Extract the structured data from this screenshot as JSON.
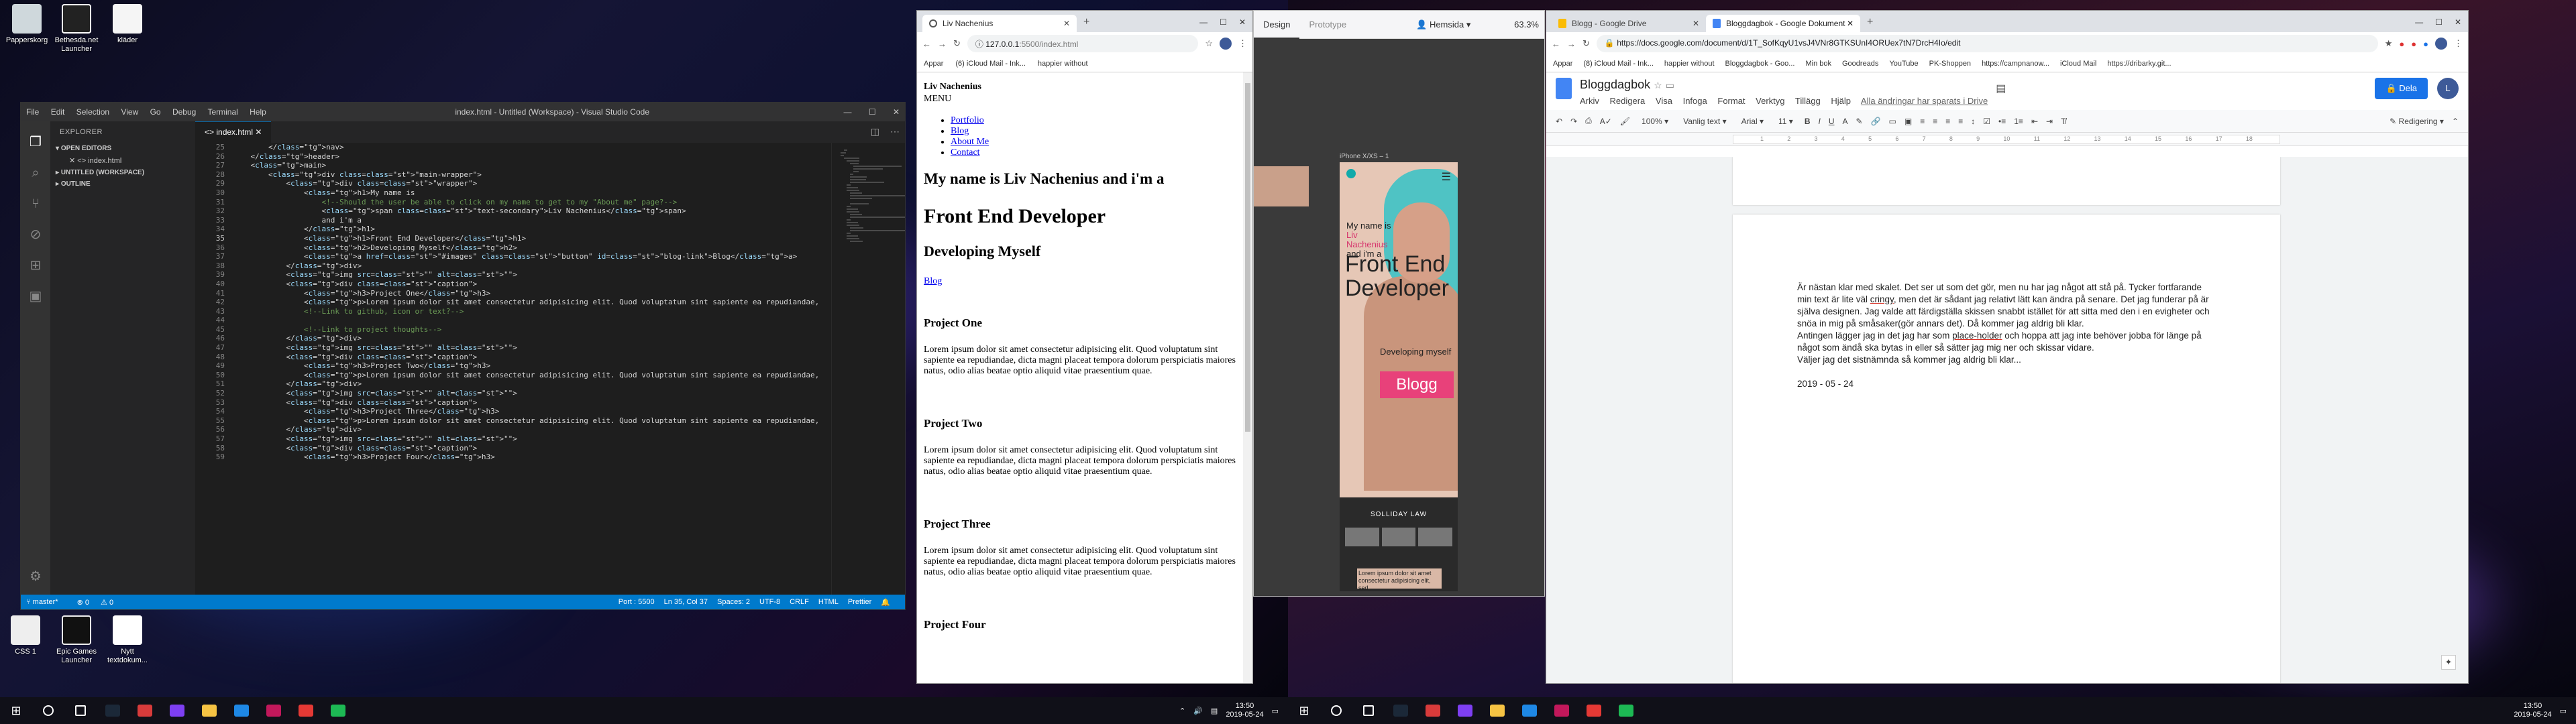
{
  "desktop": {
    "icons_left": [
      {
        "label": "Papperskorg",
        "color": "#cfd8dc"
      },
      {
        "label": "Bethesda.net Launcher",
        "color": "#222222"
      },
      {
        "label": "kläder",
        "color": "#f5f5f5"
      },
      {
        "label": "CSS 1",
        "color": "#eeeeee"
      },
      {
        "label": "Epic Games Launcher",
        "color": "#111111"
      },
      {
        "label": "Nytt textdokum...",
        "color": "#ffffff"
      }
    ]
  },
  "vscode": {
    "window_title": "index.html - Untitled (Workspace) - Visual Studio Code",
    "menu": [
      "File",
      "Edit",
      "Selection",
      "View",
      "Go",
      "Debug",
      "Terminal",
      "Help"
    ],
    "sidebar_title": "EXPLORER",
    "open_editors": "OPEN EDITORS",
    "open_file": "index.html",
    "workspace": "UNTITLED (WORKSPACE)",
    "outline": "OUTLINE",
    "tab": "index.html",
    "line_numbers": [
      "25",
      "26",
      "27",
      "28",
      "29",
      "30",
      "31",
      "32",
      "33",
      "34",
      "35",
      "36",
      "37",
      "38",
      "39",
      "40",
      "41",
      "42",
      "43",
      "44",
      "45",
      "46",
      "47",
      "48",
      "49",
      "50",
      "51",
      "52",
      "53",
      "54",
      "55",
      "56",
      "57",
      "58",
      "59"
    ],
    "code_lines": [
      "        </nav>",
      "    </header>",
      "    <main>",
      "        <div class=\"main-wrapper\">",
      "            <div class=\"wrapper\">",
      "                <h1>My name is",
      "                    <!--Should the user be able to click on my name to get to my \"About me\" page?-->",
      "                    <span class=\"text-secondary\">Liv Nachenius</span>",
      "                    and i'm a",
      "                </h1>",
      "                <h1>Front End Developer</h1>",
      "                <h2>Developing Myself</h2>",
      "                <a href=\"#images\" class=\"button\" id=\"blog-link\">Blog</a>",
      "            </div>",
      "            <img src=\"\" alt=\"\">",
      "            <div class=\"caption\">",
      "                <h3>Project One</h3>",
      "                <p>Lorem ipsum dolor sit amet consectetur adipisicing elit. Quod voluptatum sint sapiente ea repudiandae,",
      "                <!--Link to github, icon or text?-->",
      "",
      "                <!--Link to project thoughts-->",
      "            </div>",
      "            <img src=\"\" alt=\"\">",
      "            <div class=\"caption\">",
      "                <h3>Project Two</h3>",
      "                <p>Lorem ipsum dolor sit amet consectetur adipisicing elit. Quod voluptatum sint sapiente ea repudiandae,",
      "            </div>",
      "            <img src=\"\" alt=\"\">",
      "            <div class=\"caption\">",
      "                <h3>Project Three</h3>",
      "                <p>Lorem ipsum dolor sit amet consectetur adipisicing elit. Quod voluptatum sint sapiente ea repudiandae,",
      "            </div>",
      "            <img src=\"\" alt=\"\">",
      "            <div class=\"caption\">",
      "                <h3>Project Four</h3>"
    ],
    "status": {
      "branch": "master*",
      "errors": "0",
      "warnings": "0",
      "port": "Port : 5500",
      "position": "Ln 35, Col 37",
      "spaces": "Spaces: 2",
      "encoding": "UTF-8",
      "eol": "CRLF",
      "language": "HTML",
      "formatter": "Prettier"
    }
  },
  "browser_local": {
    "tab_title": "Liv Nachenius",
    "url": "127.0.0.1",
    "url_rest": ":5500/index.html",
    "bookmarks": [
      "Appar",
      "(6) iCloud Mail - Ink...",
      "happier without"
    ],
    "page": {
      "brand": "Liv Nachenius",
      "menu": "MENU",
      "nav": [
        "Portfolio",
        "Blog",
        "About Me",
        "Contact"
      ],
      "heading1": "My name is Liv Nachenius and i'm a",
      "heading2": "Front End Developer",
      "heading3": "Developing Myself",
      "blog_link": "Blog",
      "projects": [
        {
          "title": "Project One",
          "text": "Lorem ipsum dolor sit amet consectetur adipisicing elit. Quod voluptatum sint sapiente ea repudiandae, dicta magni placeat tempora dolorum perspiciatis maiores natus, odio alias beatae optio aliquid vitae praesentium quae."
        },
        {
          "title": "Project Two",
          "text": "Lorem ipsum dolor sit amet consectetur adipisicing elit. Quod voluptatum sint sapiente ea repudiandae, dicta magni placeat tempora dolorum perspiciatis maiores natus, odio alias beatae optio aliquid vitae praesentium quae."
        },
        {
          "title": "Project Three",
          "text": "Lorem ipsum dolor sit amet consectetur adipisicing elit. Quod voluptatum sint sapiente ea repudiandae, dicta magni placeat tempora dolorum perspiciatis maiores natus, odio alias beatae optio aliquid vitae praesentium quae."
        },
        {
          "title": "Project Four",
          "text": ""
        }
      ]
    }
  },
  "design_app": {
    "tabs": [
      "Design",
      "Prototype"
    ],
    "user": "Hemsida",
    "zoom": "63.3%",
    "artboard_label": "iPhone X/XS – 1",
    "mock": {
      "line1": "My name is",
      "line2": "Liv",
      "line3": "Nachenius",
      "line4": "and i'm a",
      "big": "Front End Developer",
      "developing": "Developing myself",
      "button": "Blogg",
      "project_heading": "SOLLIDAY LAW",
      "caption": "Lorem ipsum dolor sit amet consectetur adipisicing elit, sed"
    }
  },
  "gdocs": {
    "tabs": [
      "Blogg - Google Drive",
      "Bloggdagbok - Google Dokument"
    ],
    "url": "https://docs.google.com/document/d/1T_SofKqyU1vsJ4VNr8GTKSUnI4ORUex7tN7DrcH4Io/edit",
    "bookmarks": [
      "Appar",
      "(8) iCloud Mail - Ink...",
      "happier without",
      "Bloggdagbok - Goo...",
      "Min bok",
      "Goodreads",
      "YouTube",
      "PK-Shoppen",
      "https://campnanow...",
      "iCloud Mail",
      "https://dribarky.git..."
    ],
    "doc_title": "Bloggdagbok",
    "menus": [
      "Arkiv",
      "Redigera",
      "Visa",
      "Infoga",
      "Format",
      "Verktyg",
      "Tillägg",
      "Hjälp"
    ],
    "saved": "Alla ändringar har sparats i Drive",
    "share": "Dela",
    "avatar": "L",
    "toolbar": {
      "zoom": "100%",
      "style": "Vanlig text",
      "font": "Arial",
      "size": "11",
      "mode": "Redigering"
    },
    "ruler": [
      "1",
      "2",
      "3",
      "4",
      "5",
      "6",
      "7",
      "8",
      "9",
      "10",
      "11",
      "12",
      "13",
      "14",
      "15",
      "16",
      "17",
      "18"
    ],
    "paragraph_1a": "Är nästan klar med skalet. Det ser ut som det gör, men nu har jag något att stå på. Tycker fortfarande min text är lite väl ",
    "paragraph_1_cringy": "cringy",
    "paragraph_1b": ", men det är sådant jag relativt lätt kan ändra på senare. Det jag funderar på är själva designen. Jag valde att färdigställa skissen snabbt istället för att sitta med den i en evigheter och snöa in mig på småsaker(gör annars det). Då kommer jag aldrig bli klar.",
    "paragraph_2a": "Antingen lägger jag in det jag har som ",
    "paragraph_2_placeholder": "place-holder",
    "paragraph_2b": " och hoppa att jag inte behöver jobba för länge på något som ändå ska bytas in eller så sätter jag mig ner och skissar vidare.",
    "paragraph_3": "Väljer jag det sistnämnda så kommer jag aldrig bli klar...",
    "date": "2019 - 05 - 24"
  },
  "taskbar": {
    "time_left": "13:50",
    "date_left": "2019-05-24",
    "time_right": "13:50",
    "date_right": "2019-05-24",
    "apps": [
      {
        "name": "search-icon",
        "color": "#ffffff"
      },
      {
        "name": "task-view-icon",
        "color": "#ffffff"
      },
      {
        "name": "steam-icon",
        "color": "#1b2838"
      },
      {
        "name": "app-icon",
        "color": "#d83b3b"
      },
      {
        "name": "app2-icon",
        "color": "#7e3ff2"
      },
      {
        "name": "folder-icon",
        "color": "#f6c343"
      },
      {
        "name": "vscode-icon",
        "color": "#1e88e5"
      },
      {
        "name": "adobe-xd-icon",
        "color": "#c2185b"
      },
      {
        "name": "chrome-icon",
        "color": "#e53935"
      },
      {
        "name": "spotify-icon",
        "color": "#1db954"
      }
    ]
  }
}
